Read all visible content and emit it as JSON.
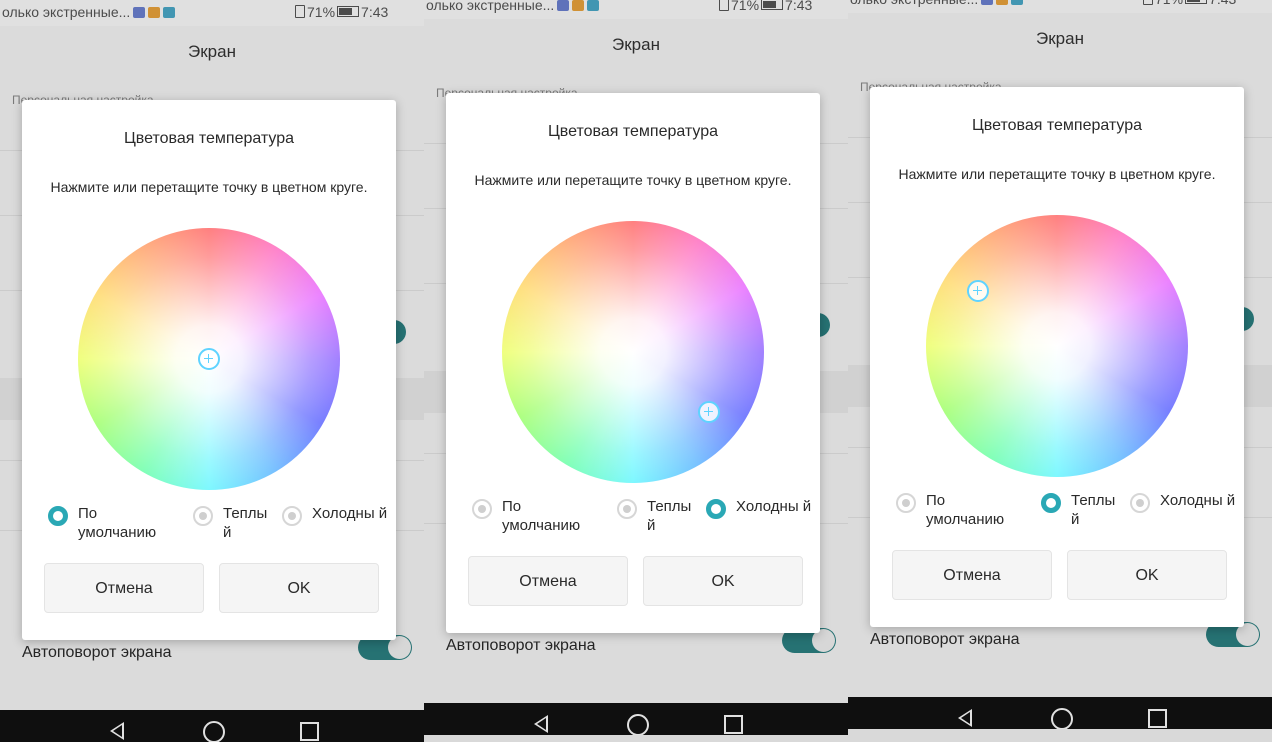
{
  "status_bar": {
    "left_text": "олько экстренные...",
    "battery": "71%",
    "time": "7:43"
  },
  "app": {
    "title": "Экран",
    "section_header": "Персональная настройка",
    "auto_rotate_label": "Автоповорот экрана"
  },
  "dialog": {
    "title": "Цветовая температура",
    "description": "Нажмите или перетащите точку в цветном круге.",
    "options": [
      {
        "label": "По умолчанию"
      },
      {
        "label": "Теплы й"
      },
      {
        "label": "Холодны й"
      }
    ],
    "cancel_label": "Отмена",
    "ok_label": "OK"
  },
  "screens": [
    {
      "selected_option": "По умолчанию",
      "marker_offset": [
        0.0,
        0.0
      ]
    },
    {
      "selected_option": "Холодны й",
      "marker_offset": [
        0.58,
        0.46
      ]
    },
    {
      "selected_option": "Теплы й",
      "marker_offset": [
        -0.6,
        -0.42
      ]
    }
  ],
  "colors": {
    "accent": "#2aa8b5",
    "toggle_on": "#2b7f80",
    "nav_bar": "#0f0f0f"
  },
  "icons": {
    "nav_back": "back-triangle-icon",
    "nav_home": "home-circle-icon",
    "nav_recent": "recent-square-icon"
  }
}
